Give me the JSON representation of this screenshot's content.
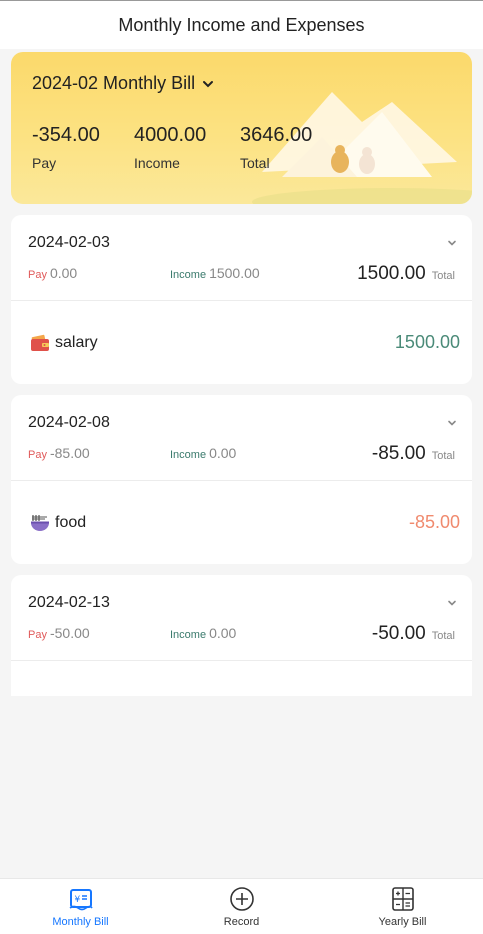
{
  "header": {
    "title": "Monthly Income and Expenses"
  },
  "summary": {
    "month_label": "2024-02 Monthly Bill",
    "pay_value": "-354.00",
    "pay_label": "Pay",
    "income_value": "4000.00",
    "income_label": "Income",
    "total_value": "3646.00",
    "total_label": "Total"
  },
  "days": [
    {
      "date": "2024-02-03",
      "pay_label": "Pay",
      "pay_value": "0.00",
      "income_label": "Income",
      "income_value": "1500.00",
      "total_value": "1500.00",
      "total_label": "Total",
      "items": [
        {
          "icon": "wallet-icon",
          "name": "salary",
          "amount": "1500.00",
          "type": "income"
        }
      ]
    },
    {
      "date": "2024-02-08",
      "pay_label": "Pay",
      "pay_value": "-85.00",
      "income_label": "Income",
      "income_value": "0.00",
      "total_value": "-85.00",
      "total_label": "Total",
      "items": [
        {
          "icon": "noodle-bowl-icon",
          "name": "food",
          "amount": "-85.00",
          "type": "expense"
        }
      ]
    },
    {
      "date": "2024-02-13",
      "pay_label": "Pay",
      "pay_value": "-50.00",
      "income_label": "Income",
      "income_value": "0.00",
      "total_value": "-50.00",
      "total_label": "Total",
      "items": []
    }
  ],
  "tabbar": {
    "tabs": [
      {
        "label": "Monthly Bill",
        "icon": "monthly-bill-icon",
        "active": true
      },
      {
        "label": "Record",
        "icon": "plus-circle-icon",
        "active": false
      },
      {
        "label": "Yearly Bill",
        "icon": "calculator-icon",
        "active": false
      }
    ]
  },
  "colors": {
    "accent": "#1677ff",
    "income": "#4a8a78",
    "expense": "#f08a6e",
    "banner": "#fbd96b"
  }
}
